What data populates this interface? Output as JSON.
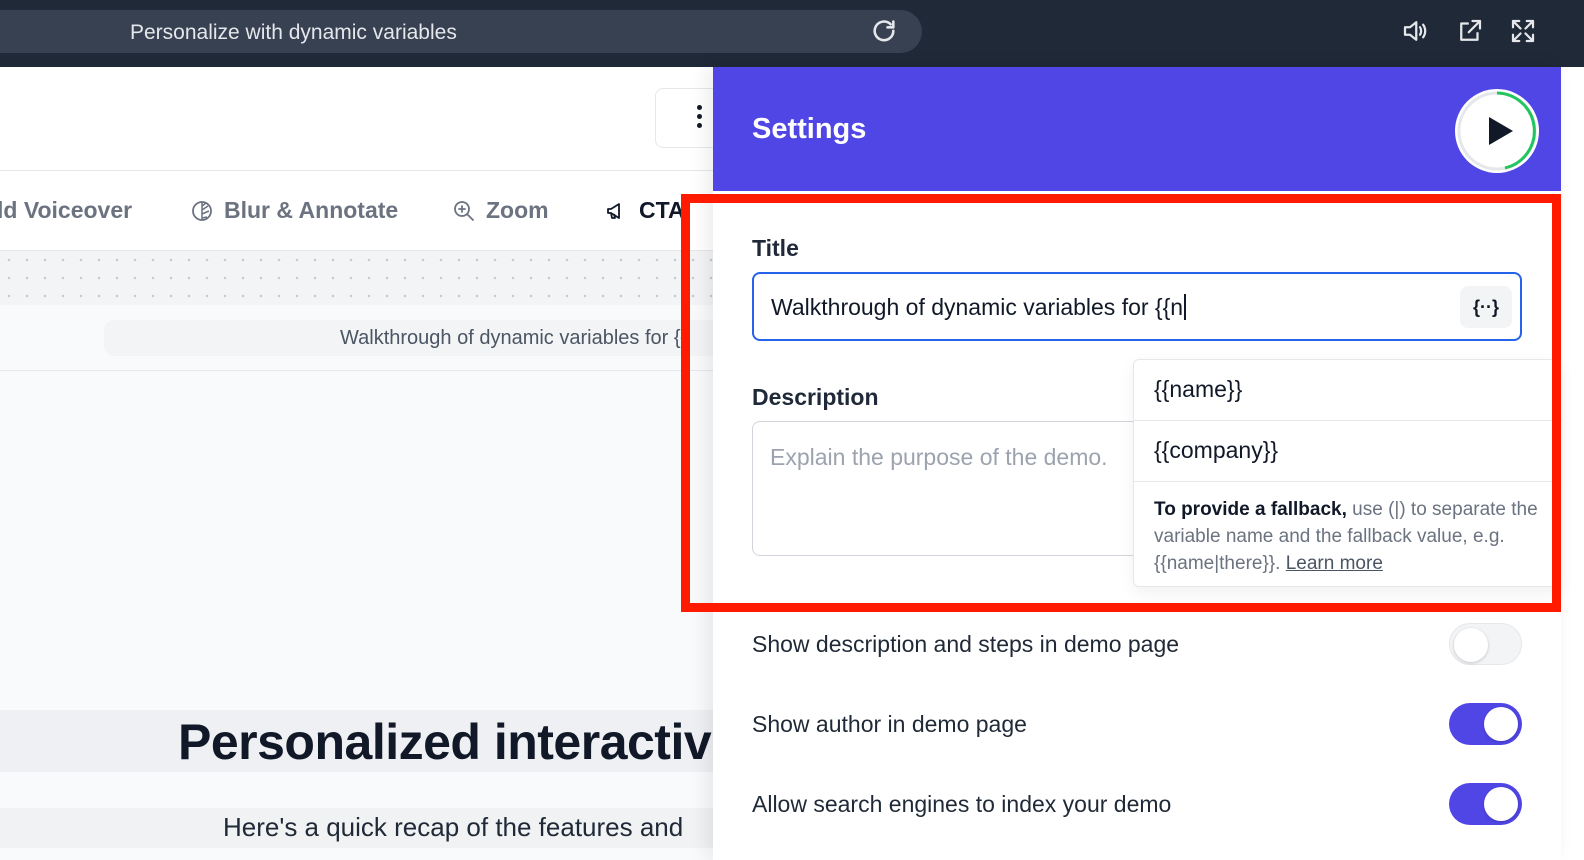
{
  "topbar": {
    "url_text": "Personalize with dynamic variables",
    "icons": [
      "reload-icon",
      "speaker-icon",
      "external-link-icon",
      "fullscreen-icon"
    ]
  },
  "editor": {
    "toolbar": {
      "items": [
        {
          "label": "ld Voiceover",
          "icon": ""
        },
        {
          "label": "Blur & Annotate",
          "icon": "blur-icon"
        },
        {
          "label": "Zoom",
          "icon": "zoom-in-icon"
        },
        {
          "label": "CTA",
          "icon": "megaphone-icon"
        }
      ]
    },
    "step_title": "Walkthrough of dynamic variables for {{",
    "heading": "Personalized interactive",
    "subheading": "Here's a quick recap of the features and"
  },
  "settings": {
    "header_title": "Settings",
    "title_label": "Title",
    "title_value": "Walkthrough of dynamic variables for {{n",
    "variable_button": "{··}",
    "description_label": "Description",
    "description_placeholder": "Explain the purpose of the demo.",
    "variable_dropdown": {
      "options": [
        "{{name}}",
        "{{company}}"
      ],
      "hint_bold": "To provide a fallback,",
      "hint_text": " use (|) to separate the variable name and the fallback value, e.g. {{name|there}}. ",
      "hint_link": "Learn more"
    },
    "toggles": [
      {
        "label": "Show description and steps in demo page",
        "on": false
      },
      {
        "label": "Show author in demo page",
        "on": true
      },
      {
        "label": "Allow search engines to index your demo",
        "on": true
      }
    ]
  },
  "colors": {
    "accent": "#4f46e5",
    "highlight": "#ff1a00",
    "focus": "#2563eb"
  }
}
